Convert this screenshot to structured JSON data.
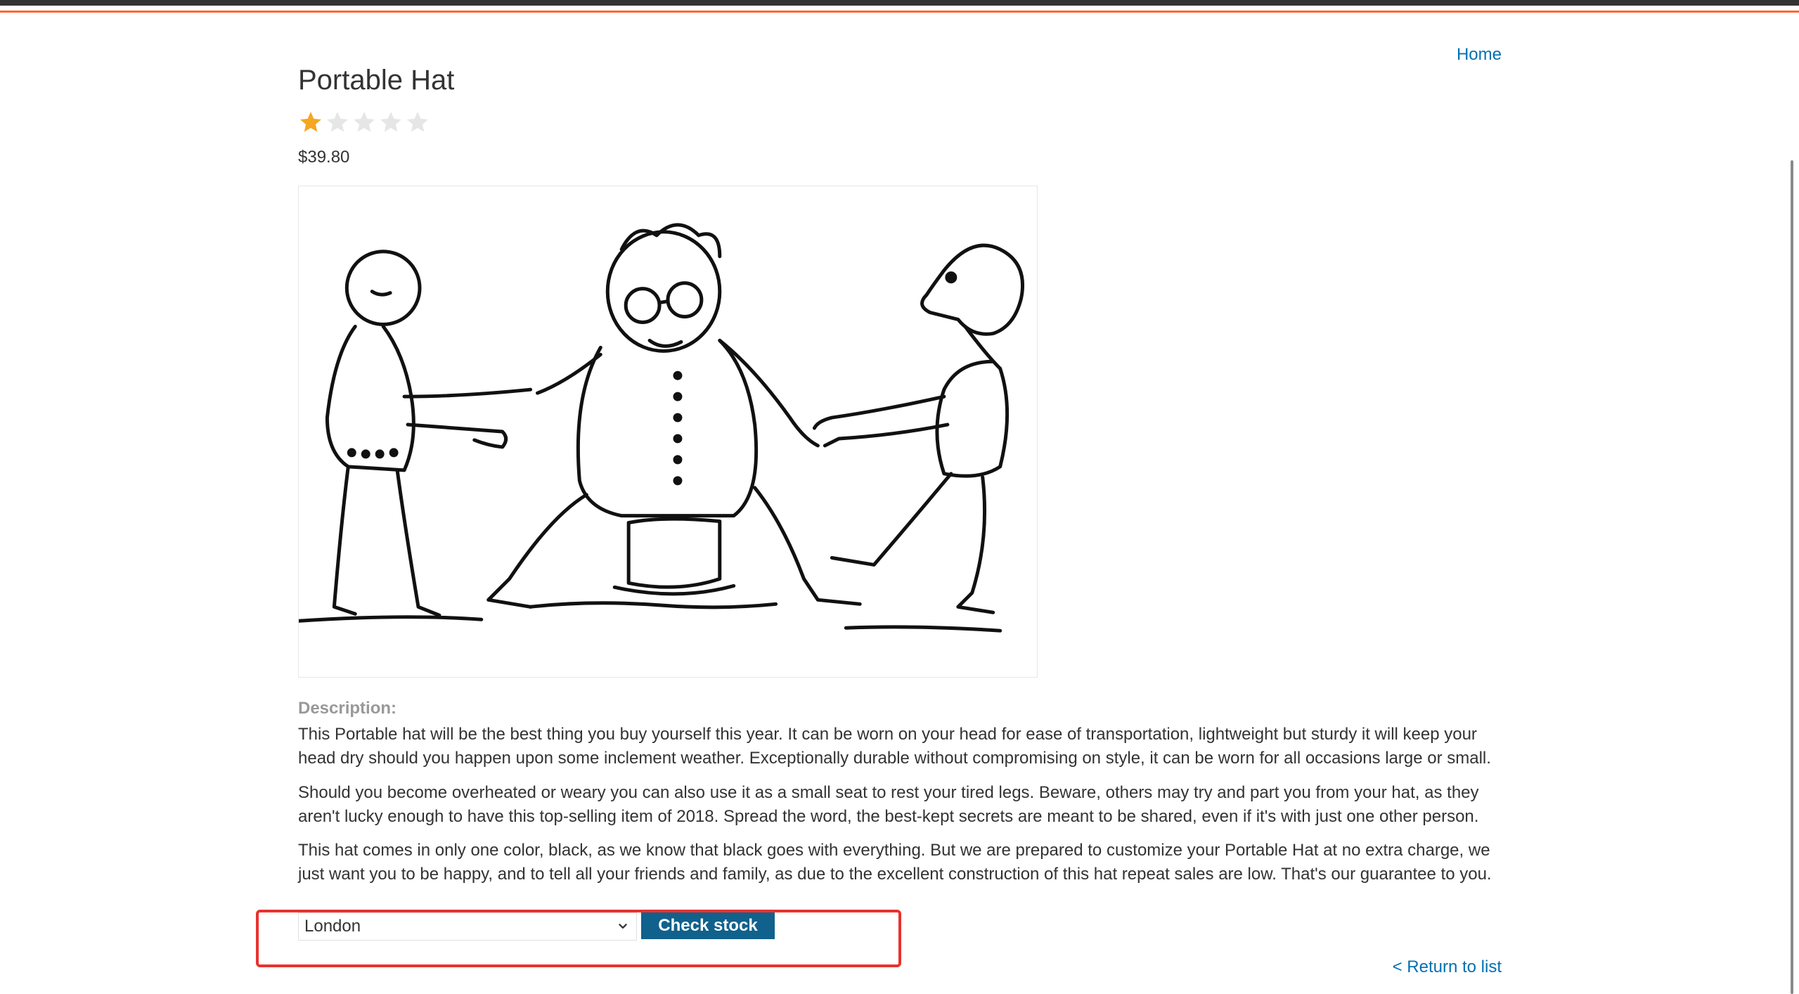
{
  "nav": {
    "home_label": "Home"
  },
  "product": {
    "title": "Portable Hat",
    "rating": {
      "value": 1,
      "max": 5
    },
    "price": "$39.80",
    "image_icon": "illustration-people-pulling-man-off-hat"
  },
  "description": {
    "label": "Description:",
    "paragraphs": [
      "This Portable hat will be the best thing you buy yourself this year. It can be worn on your head for ease of transportation, lightweight but sturdy it will keep your head dry should you happen upon some inclement weather. Exceptionally durable without compromising on style, it can be worn for all occasions large or small.",
      "Should you become overheated or weary you can also use it as a small seat to rest your tired legs. Beware, others may try and part you from your hat, as they aren't lucky enough to have this top-selling item of 2018. Spread the word, the best-kept secrets are meant to be shared, even if it's with just one other person.",
      "This hat comes in only one color, black, as we know that black goes with everything. But we are prepared to customize your Portable Hat at no extra charge, we just want you to be happy, and to tell all your friends and family, as due to the excellent construction of this hat repeat sales are low. That's our guarantee to you."
    ]
  },
  "stock_check": {
    "selected_store": "London",
    "button_label": "Check stock"
  },
  "footer": {
    "return_label": "< Return to list"
  },
  "colors": {
    "accent_bar": "#ff6633",
    "link": "#0070b3",
    "button": "#10618c",
    "star_filled": "#f5a623",
    "star_empty": "#e6e6e6",
    "highlight": "#e8322e"
  }
}
